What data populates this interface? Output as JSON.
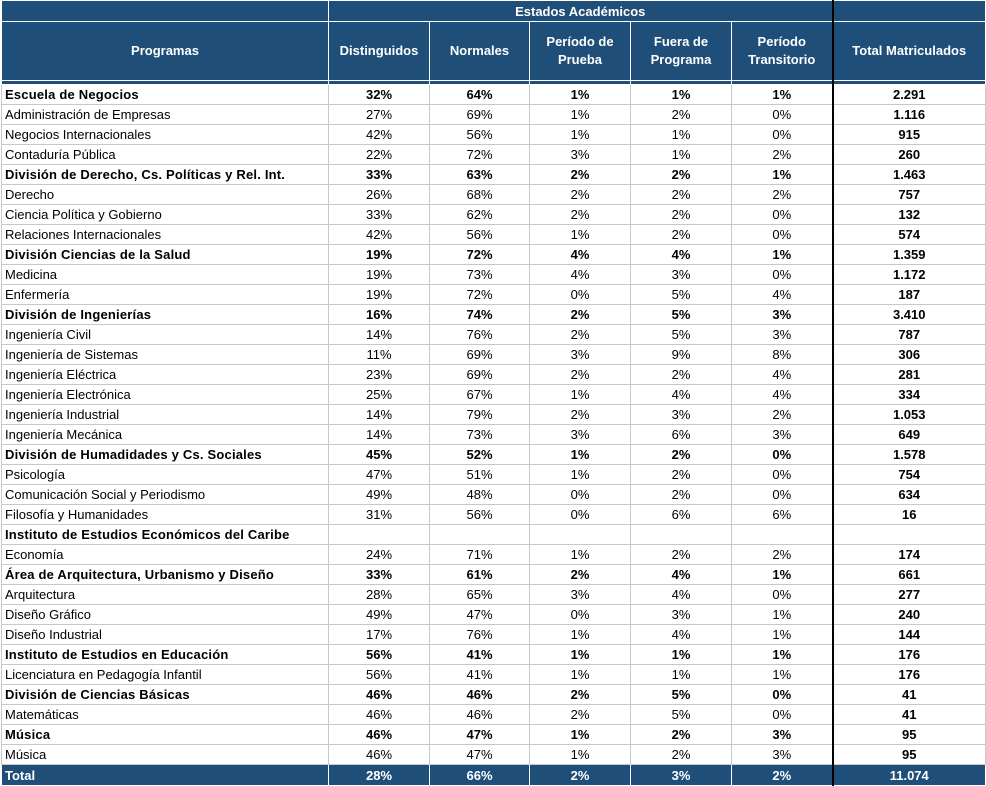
{
  "header": {
    "group_title": "Estados Académicos",
    "programas": "Programas",
    "distinguidos": "Distinguidos",
    "normales": "Normales",
    "prueba": "Período de Prueba",
    "fuera": "Fuera de Programa",
    "transitorio": "Período Transitorio",
    "total": "Total Matriculados"
  },
  "rows": [
    {
      "type": "group",
      "name": "Escuela de Negocios",
      "dist": "32%",
      "norm": "64%",
      "prueba": "1%",
      "fuera": "1%",
      "trans": "1%",
      "total": "2.291"
    },
    {
      "type": "item",
      "name": "Administración de Empresas",
      "dist": "27%",
      "norm": "69%",
      "prueba": "1%",
      "fuera": "2%",
      "trans": "0%",
      "total": "1.116"
    },
    {
      "type": "item",
      "name": "Negocios Internacionales",
      "dist": "42%",
      "norm": "56%",
      "prueba": "1%",
      "fuera": "1%",
      "trans": "0%",
      "total": "915"
    },
    {
      "type": "item",
      "name": "Contaduría Pública",
      "dist": "22%",
      "norm": "72%",
      "prueba": "3%",
      "fuera": "1%",
      "trans": "2%",
      "total": "260"
    },
    {
      "type": "group",
      "name": "División de Derecho, Cs. Políticas y Rel. Int.",
      "dist": "33%",
      "norm": "63%",
      "prueba": "2%",
      "fuera": "2%",
      "trans": "1%",
      "total": "1.463"
    },
    {
      "type": "item",
      "name": "Derecho",
      "dist": "26%",
      "norm": "68%",
      "prueba": "2%",
      "fuera": "2%",
      "trans": "2%",
      "total": "757"
    },
    {
      "type": "item",
      "name": "Ciencia Política y Gobierno",
      "dist": "33%",
      "norm": "62%",
      "prueba": "2%",
      "fuera": "2%",
      "trans": "0%",
      "total": "132"
    },
    {
      "type": "item",
      "name": "Relaciones Internacionales",
      "dist": "42%",
      "norm": "56%",
      "prueba": "1%",
      "fuera": "2%",
      "trans": "0%",
      "total": "574"
    },
    {
      "type": "group",
      "name": "División Ciencias de la Salud",
      "dist": "19%",
      "norm": "72%",
      "prueba": "4%",
      "fuera": "4%",
      "trans": "1%",
      "total": "1.359"
    },
    {
      "type": "item",
      "name": "Medicina",
      "dist": "19%",
      "norm": "73%",
      "prueba": "4%",
      "fuera": "3%",
      "trans": "0%",
      "total": "1.172"
    },
    {
      "type": "item",
      "name": "Enfermería",
      "dist": "19%",
      "norm": "72%",
      "prueba": "0%",
      "fuera": "5%",
      "trans": "4%",
      "total": "187"
    },
    {
      "type": "group",
      "name": "División de Ingenierías",
      "dist": "16%",
      "norm": "74%",
      "prueba": "2%",
      "fuera": "5%",
      "trans": "3%",
      "total": "3.410"
    },
    {
      "type": "item",
      "name": "Ingeniería Civil",
      "dist": "14%",
      "norm": "76%",
      "prueba": "2%",
      "fuera": "5%",
      "trans": "3%",
      "total": "787"
    },
    {
      "type": "item",
      "name": "Ingeniería de Sistemas",
      "dist": "11%",
      "norm": "69%",
      "prueba": "3%",
      "fuera": "9%",
      "trans": "8%",
      "total": "306"
    },
    {
      "type": "item",
      "name": "Ingeniería Eléctrica",
      "dist": "23%",
      "norm": "69%",
      "prueba": "2%",
      "fuera": "2%",
      "trans": "4%",
      "total": "281"
    },
    {
      "type": "item",
      "name": "Ingeniería Electrónica",
      "dist": "25%",
      "norm": "67%",
      "prueba": "1%",
      "fuera": "4%",
      "trans": "4%",
      "total": "334"
    },
    {
      "type": "item",
      "name": "Ingeniería Industrial",
      "dist": "14%",
      "norm": "79%",
      "prueba": "2%",
      "fuera": "3%",
      "trans": "2%",
      "total": "1.053"
    },
    {
      "type": "item",
      "name": "Ingeniería Mecánica",
      "dist": "14%",
      "norm": "73%",
      "prueba": "3%",
      "fuera": "6%",
      "trans": "3%",
      "total": "649"
    },
    {
      "type": "group",
      "name": "División de Humadidades y Cs. Sociales",
      "dist": "45%",
      "norm": "52%",
      "prueba": "1%",
      "fuera": "2%",
      "trans": "0%",
      "total": "1.578"
    },
    {
      "type": "item",
      "name": "Psicología",
      "dist": "47%",
      "norm": "51%",
      "prueba": "1%",
      "fuera": "2%",
      "trans": "0%",
      "total": "754"
    },
    {
      "type": "item",
      "name": "Comunicación Social y Periodismo",
      "dist": "49%",
      "norm": "48%",
      "prueba": "0%",
      "fuera": "2%",
      "trans": "0%",
      "total": "634"
    },
    {
      "type": "item",
      "name": "Filosofía y Humanidades",
      "dist": "31%",
      "norm": "56%",
      "prueba": "0%",
      "fuera": "6%",
      "trans": "6%",
      "total": "16"
    },
    {
      "type": "group",
      "name": "Instituto de Estudios Económicos del Caribe",
      "dist": "",
      "norm": "",
      "prueba": "",
      "fuera": "",
      "trans": "",
      "total": ""
    },
    {
      "type": "item",
      "name": "Economía",
      "dist": "24%",
      "norm": "71%",
      "prueba": "1%",
      "fuera": "2%",
      "trans": "2%",
      "total": "174"
    },
    {
      "type": "group",
      "name": "Área de Arquitectura, Urbanismo y Diseño",
      "dist": "33%",
      "norm": "61%",
      "prueba": "2%",
      "fuera": "4%",
      "trans": "1%",
      "total": "661"
    },
    {
      "type": "item",
      "name": "Arquitectura",
      "dist": "28%",
      "norm": "65%",
      "prueba": "3%",
      "fuera": "4%",
      "trans": "0%",
      "total": "277"
    },
    {
      "type": "item",
      "name": "Diseño Gráfico",
      "dist": "49%",
      "norm": "47%",
      "prueba": "0%",
      "fuera": "3%",
      "trans": "1%",
      "total": "240"
    },
    {
      "type": "item",
      "name": "Diseño Industrial",
      "dist": "17%",
      "norm": "76%",
      "prueba": "1%",
      "fuera": "4%",
      "trans": "1%",
      "total": "144"
    },
    {
      "type": "group",
      "name": "Instituto de Estudios en Educación",
      "dist": "56%",
      "norm": "41%",
      "prueba": "1%",
      "fuera": "1%",
      "trans": "1%",
      "total": "176"
    },
    {
      "type": "item",
      "name": "Licenciatura en Pedagogía Infantil",
      "dist": "56%",
      "norm": "41%",
      "prueba": "1%",
      "fuera": "1%",
      "trans": "1%",
      "total": "176"
    },
    {
      "type": "group",
      "name": "División de Ciencias Básicas",
      "dist": "46%",
      "norm": "46%",
      "prueba": "2%",
      "fuera": "5%",
      "trans": "0%",
      "total": "41"
    },
    {
      "type": "item",
      "name": "Matemáticas",
      "dist": "46%",
      "norm": "46%",
      "prueba": "2%",
      "fuera": "5%",
      "trans": "0%",
      "total": "41"
    },
    {
      "type": "group",
      "name": "Música",
      "dist": "46%",
      "norm": "47%",
      "prueba": "1%",
      "fuera": "2%",
      "trans": "3%",
      "total": "95"
    },
    {
      "type": "item",
      "name": "Música",
      "dist": "46%",
      "norm": "47%",
      "prueba": "1%",
      "fuera": "2%",
      "trans": "3%",
      "total": "95"
    }
  ],
  "total_row": {
    "name": "Total",
    "dist": "28%",
    "norm": "66%",
    "prueba": "2%",
    "fuera": "3%",
    "trans": "2%",
    "total": "11.074"
  },
  "colors": {
    "header_bg": "#1f4e79",
    "header_text": "#ffffff"
  }
}
